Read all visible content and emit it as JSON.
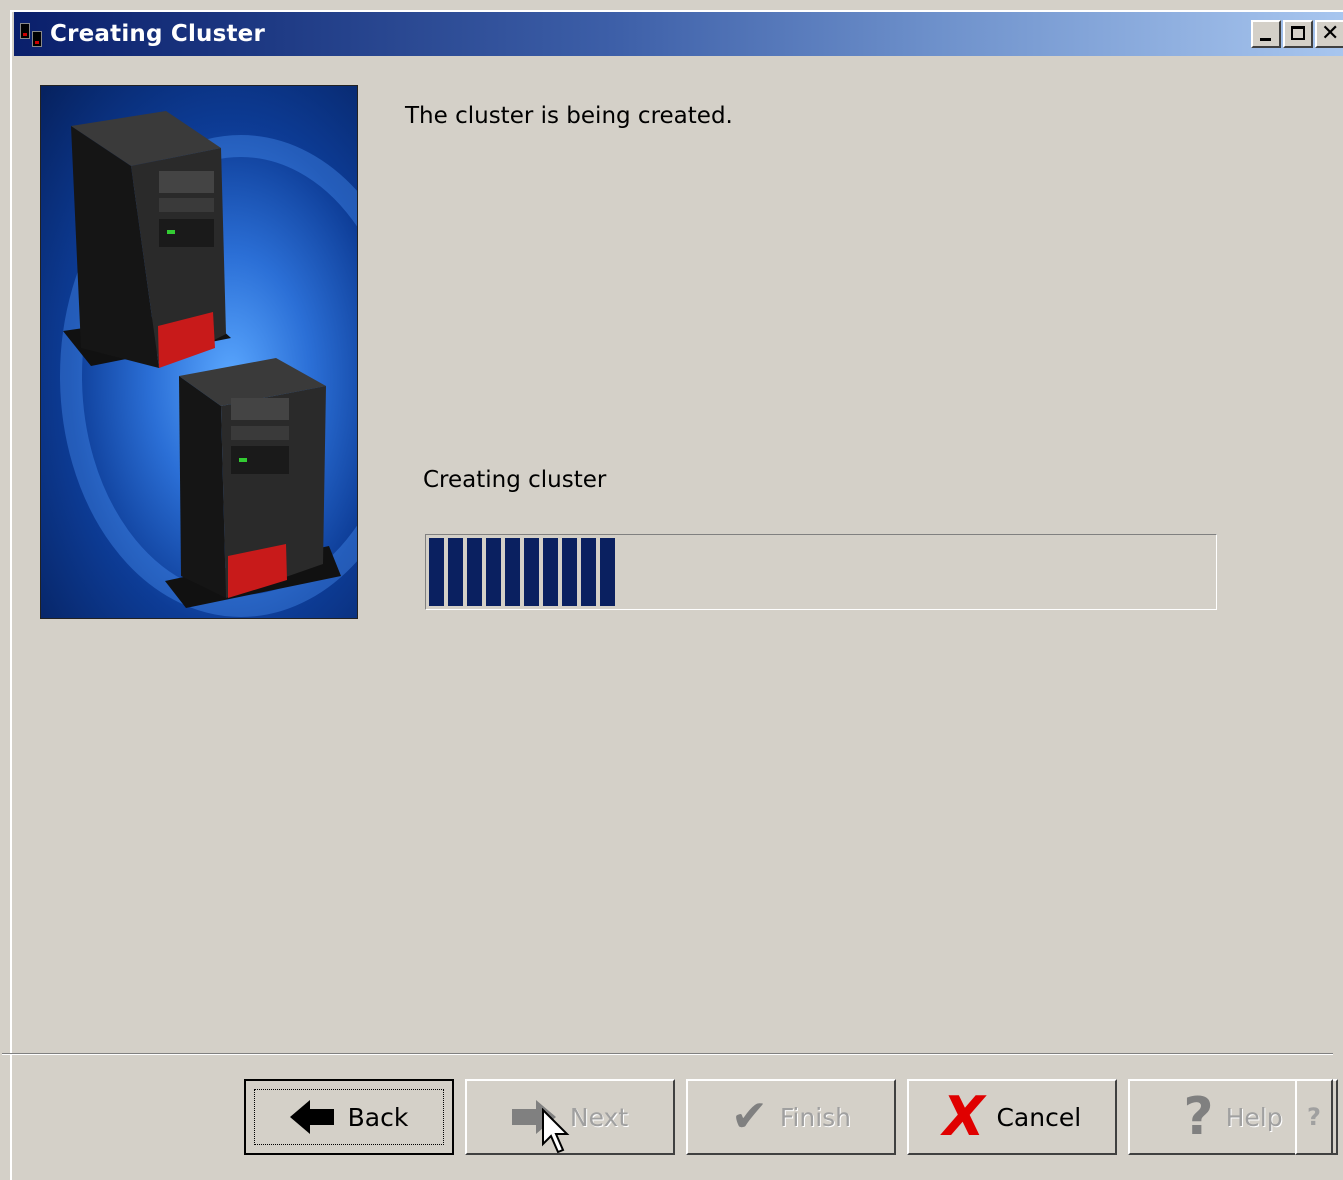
{
  "window": {
    "title": "Creating Cluster",
    "controls": [
      "minimize",
      "maximize",
      "close"
    ]
  },
  "hero_image": {
    "subject": "two tower servers on blue background"
  },
  "content": {
    "description": "The cluster is being created.",
    "progress": {
      "label": "Creating cluster",
      "value": 0.25,
      "color": "#0a2060"
    }
  },
  "buttons": {
    "back": {
      "label": "Back",
      "icon": "arrow-left-icon",
      "enabled": true
    },
    "next": {
      "label": "Next",
      "icon": "arrow-right-icon",
      "enabled": false
    },
    "finish": {
      "label": "Finish",
      "icon": "checkmark-icon",
      "enabled": false
    },
    "cancel": {
      "label": "Cancel",
      "icon": "red-x-icon",
      "enabled": true
    },
    "help": {
      "label": "Help",
      "icon": "question-mark-icon",
      "enabled": false
    },
    "context_help": {
      "label": "?"
    }
  },
  "colors": {
    "dialog_bg": "#d4d0c8",
    "cancel_icon": "#e00000"
  }
}
